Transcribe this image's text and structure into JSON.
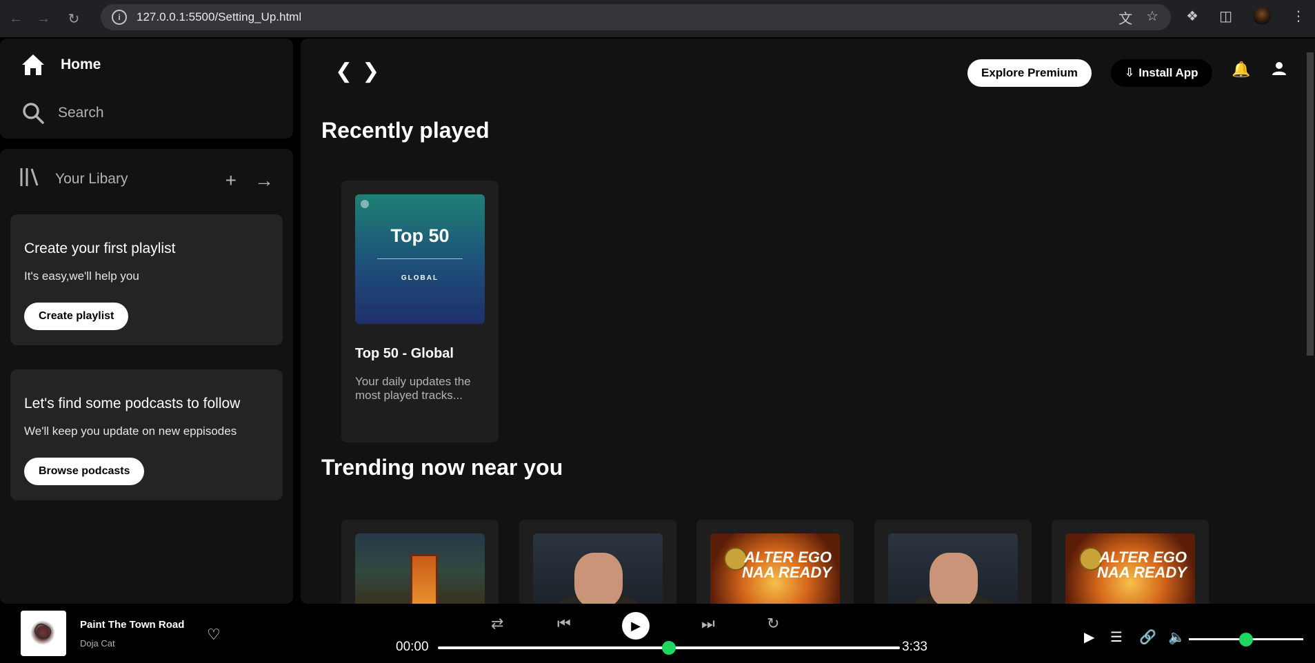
{
  "browser": {
    "url": "127.0.0.1:5500/Setting_Up.html"
  },
  "sidebar": {
    "home_label": "Home",
    "search_label": "Search",
    "library_label": "Your Libary",
    "cards": [
      {
        "title": "Create your first playlist",
        "subtitle": "It's easy,we'll help you",
        "button": "Create playlist"
      },
      {
        "title": "Let's find some podcasts to follow",
        "subtitle": "We'll keep you update on new eppisodes",
        "button": "Browse podcasts"
      }
    ]
  },
  "header": {
    "premium_label": "Explore Premium",
    "install_label": "Install App"
  },
  "recently_played": {
    "title": "Recently played",
    "items": [
      {
        "cover_title": "Top 50",
        "cover_subtitle": "GLOBAL",
        "name": "Top 50 - Global",
        "description": "Your daily updates the most played tracks..."
      }
    ]
  },
  "trending": {
    "title": "Trending now near you",
    "covers": [
      {
        "fire_text": ""
      },
      {
        "fire_text": ""
      },
      {
        "fire_text": "ALTER EGO NAA READY"
      },
      {
        "fire_text": ""
      },
      {
        "fire_text": "ALTER EGO NAA READY"
      }
    ]
  },
  "player": {
    "song": "Paint The Town Road",
    "artist": "Doja Cat",
    "current_time": "00:00",
    "total_time": "3:33",
    "progress": 0.5,
    "volume": 0.5
  },
  "colors": {
    "accent": "#1ed760",
    "background": "#121212",
    "card": "#242424"
  }
}
